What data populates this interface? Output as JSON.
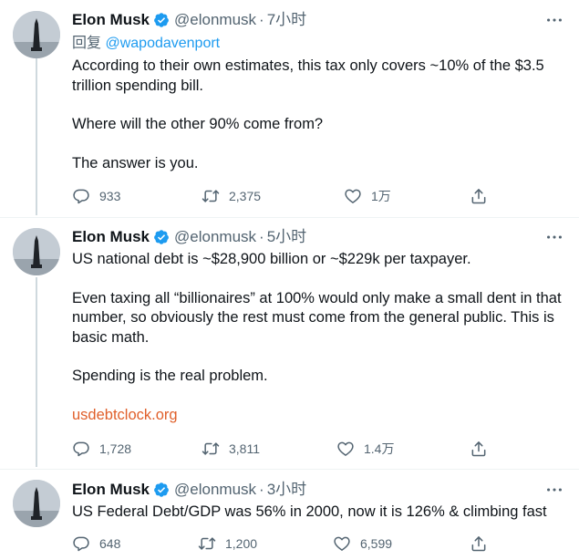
{
  "tweets": [
    {
      "author": {
        "name": "Elon Musk",
        "handle": "@elonmusk",
        "verified": true
      },
      "time": "7小时",
      "reply_to": {
        "prefix": "回复",
        "mention": "@wapodavenport"
      },
      "paragraphs": [
        "According to their own estimates, this tax only covers ~10% of the $3.5 trillion spending bill.",
        "Where will the other 90% come from?",
        "The answer is you."
      ],
      "link": "",
      "stats": {
        "replies": "933",
        "retweets": "2,375",
        "likes": "1万"
      }
    },
    {
      "author": {
        "name": "Elon Musk",
        "handle": "@elonmusk",
        "verified": true
      },
      "time": "5小时",
      "paragraphs": [
        "US national debt is ~$28,900 billion or ~$229k per taxpayer.",
        "Even taxing all “billionaires” at 100% would only make a small dent in that number, so obviously the rest must come from the general public. This is basic math.",
        "Spending is the real problem."
      ],
      "link": "usdebtclock.org",
      "stats": {
        "replies": "1,728",
        "retweets": "3,811",
        "likes": "1.4万"
      }
    },
    {
      "author": {
        "name": "Elon Musk",
        "handle": "@elonmusk",
        "verified": true
      },
      "time": "3小时",
      "paragraphs": [
        "US Federal Debt/GDP was 56% in 2000, now it is 126% & climbing fast"
      ],
      "link": "",
      "stats": {
        "replies": "648",
        "retweets": "1,200",
        "likes": "6,599"
      }
    }
  ],
  "separator": "·",
  "colors": {
    "accent": "#1d9bf0",
    "link": "#e0602b",
    "muted": "#536471",
    "thread_line": "#cfd9de"
  },
  "icons": [
    "verified-badge-icon",
    "more-icon",
    "reply-icon",
    "retweet-icon",
    "like-icon",
    "share-icon"
  ]
}
